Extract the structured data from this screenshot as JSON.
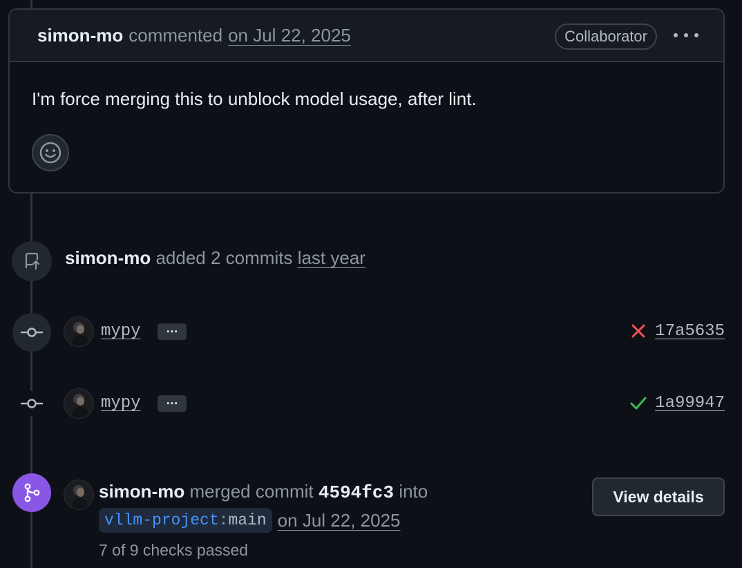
{
  "comment": {
    "author": "simon-mo",
    "action": "commented",
    "date": "on Jul 22, 2025",
    "role_badge": "Collaborator",
    "body": "I'm force merging this to unblock model usage, after lint."
  },
  "added_commits_event": {
    "author": "simon-mo",
    "action": "added 2 commits",
    "time": "last year"
  },
  "commits": [
    {
      "message": "mypy",
      "expand": "…",
      "status": "failure",
      "status_color": "#f85149",
      "sha": "17a5635"
    },
    {
      "message": "mypy",
      "expand": "…",
      "status": "success",
      "status_color": "#3fb950",
      "sha": "1a99947"
    }
  ],
  "merge_event": {
    "author": "simon-mo",
    "action_prefix": "merged commit",
    "commit_id": "4594fc3",
    "action_suffix": "into",
    "branch_owner": "vllm-project",
    "branch_sep": ":",
    "branch_name": "main",
    "date": "on Jul 22, 2025",
    "checks": "7 of 9 checks passed",
    "view_details": "View details",
    "icon_color": "#8957e5"
  }
}
